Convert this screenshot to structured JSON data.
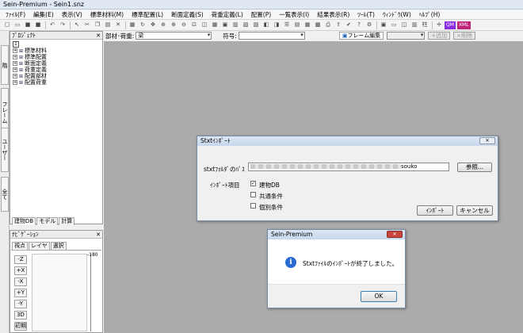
{
  "window": {
    "title": "Sein-Premium - Sein1.snz"
  },
  "menu": [
    "ﾌｧｲﾙ(F)",
    "編集(E)",
    "表示(V)",
    "標準材料(M)",
    "標準配置(L)",
    "断面定義(S)",
    "荷重定義(L)",
    "配置(P)",
    "一覧表示(I)",
    "結果表示(R)",
    "ﾂｰﾙ(T)",
    "ｳｨﾝﾄﾞｳ(W)",
    "ﾍﾙﾌﾟ(H)"
  ],
  "toolbar": {
    "badges": [
      {
        "text": "QM",
        "color": "#8a2be2"
      },
      {
        "text": "XML",
        "color": "#c0237a"
      }
    ],
    "column_label": "柱"
  },
  "propbar": {
    "member_label": "部材･荷重:",
    "member_value": "梁",
    "code_label": "符号:",
    "code_value": "",
    "frame_edit": "フレーム編集",
    "add_label": "+追加",
    "delete_label": "×削除"
  },
  "side_tabs": [
    "階",
    "フレーム",
    "ユーザー",
    "全て"
  ],
  "project_panel": {
    "title": "ﾌﾟﾛｼﾞｪｸﾄ",
    "root": "1",
    "items": [
      "標準材料",
      "標準配置",
      "断面定義",
      "荷重定義",
      "配置部材",
      "配置荷重"
    ],
    "tabs": [
      "建物DB",
      "モデル",
      "計算"
    ]
  },
  "nav_panel": {
    "title": "ﾅﾋﾞｹﾞｰｼｮﾝ",
    "tabs": [
      "視点",
      "レイヤ",
      "選択"
    ],
    "buttons": [
      "-Z",
      "+X",
      "-X",
      "+Y",
      "-Y",
      "3D",
      "初期"
    ],
    "scale_top": "-180"
  },
  "import_dialog": {
    "title": "Stxtｲﾝﾎﾟｰﾄ",
    "folder_label": "stxtﾌｫﾙﾀﾞのﾊﾟｽ",
    "folder_value": "souko",
    "browse_label": "参照...",
    "items_label": "ｲﾝﾎﾟｰﾄ項目",
    "checks": [
      {
        "label": "建物DB",
        "checked": true
      },
      {
        "label": "共通条件",
        "checked": false
      },
      {
        "label": "個別条件",
        "checked": false
      }
    ],
    "import_button": "ｲﾝﾎﾟｰﾄ",
    "cancel_button": "キャンセル"
  },
  "message_box": {
    "title": "Sein-Premium",
    "message": "Stxtﾌｧｲﾙのｲﾝﾎﾟｰﾄが終了しました。",
    "ok_button": "OK"
  }
}
